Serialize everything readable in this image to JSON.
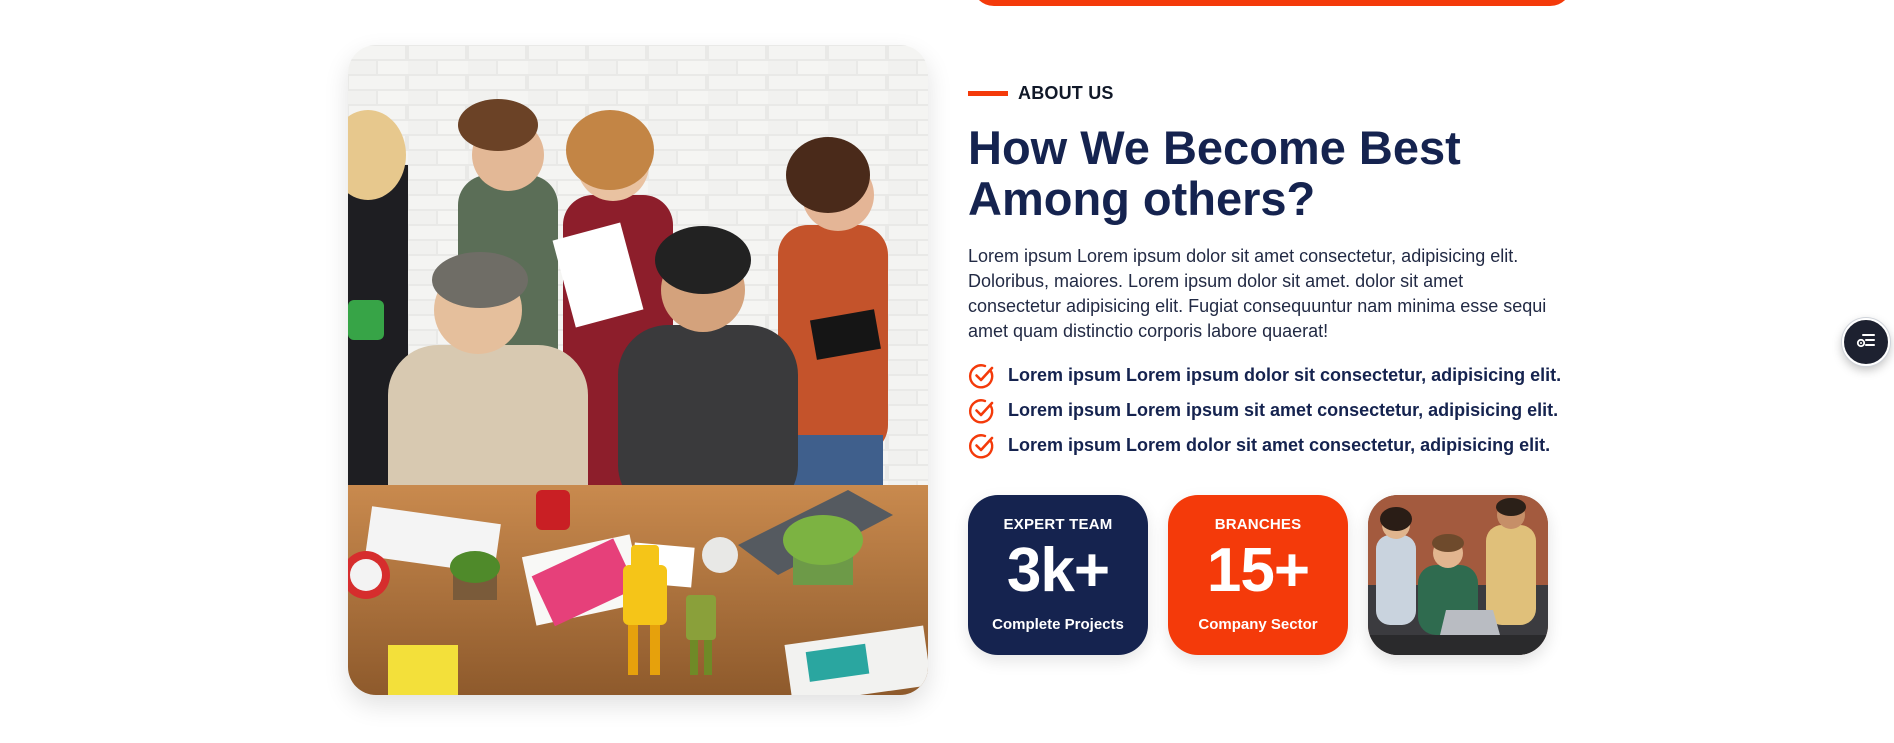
{
  "about": {
    "eyebrow": "ABOUT US",
    "heading_line1": "How We Become Best",
    "heading_line2": "Among others?",
    "paragraph": "Lorem ipsum Lorem ipsum dolor sit amet consectetur, adipisicing elit. Doloribus, maiores. Lorem ipsum dolor sit amet. dolor sit amet consectetur adipisicing elit. Fugiat consequuntur nam minima esse sequi amet quam distinctio corporis labore quaerat!",
    "checklist": [
      "Lorem ipsum Lorem ipsum dolor sit consectetur, adipisicing elit.",
      "Lorem ipsum Lorem ipsum sit amet consectetur, adipisicing elit.",
      "Lorem ipsum Lorem dolor sit amet consectetur, adipisicing elit."
    ]
  },
  "stats": [
    {
      "label": "EXPERT TEAM",
      "value": "3k+",
      "caption": "Complete Projects"
    },
    {
      "label": "BRANCHES",
      "value": "15+",
      "caption": "Company Sector"
    }
  ],
  "icons": {
    "check": "check-circle-icon",
    "float_button": "settings-menu-icon"
  },
  "colors": {
    "accent": "#f43a0a",
    "navy": "#15234f",
    "text": "#222a44"
  }
}
